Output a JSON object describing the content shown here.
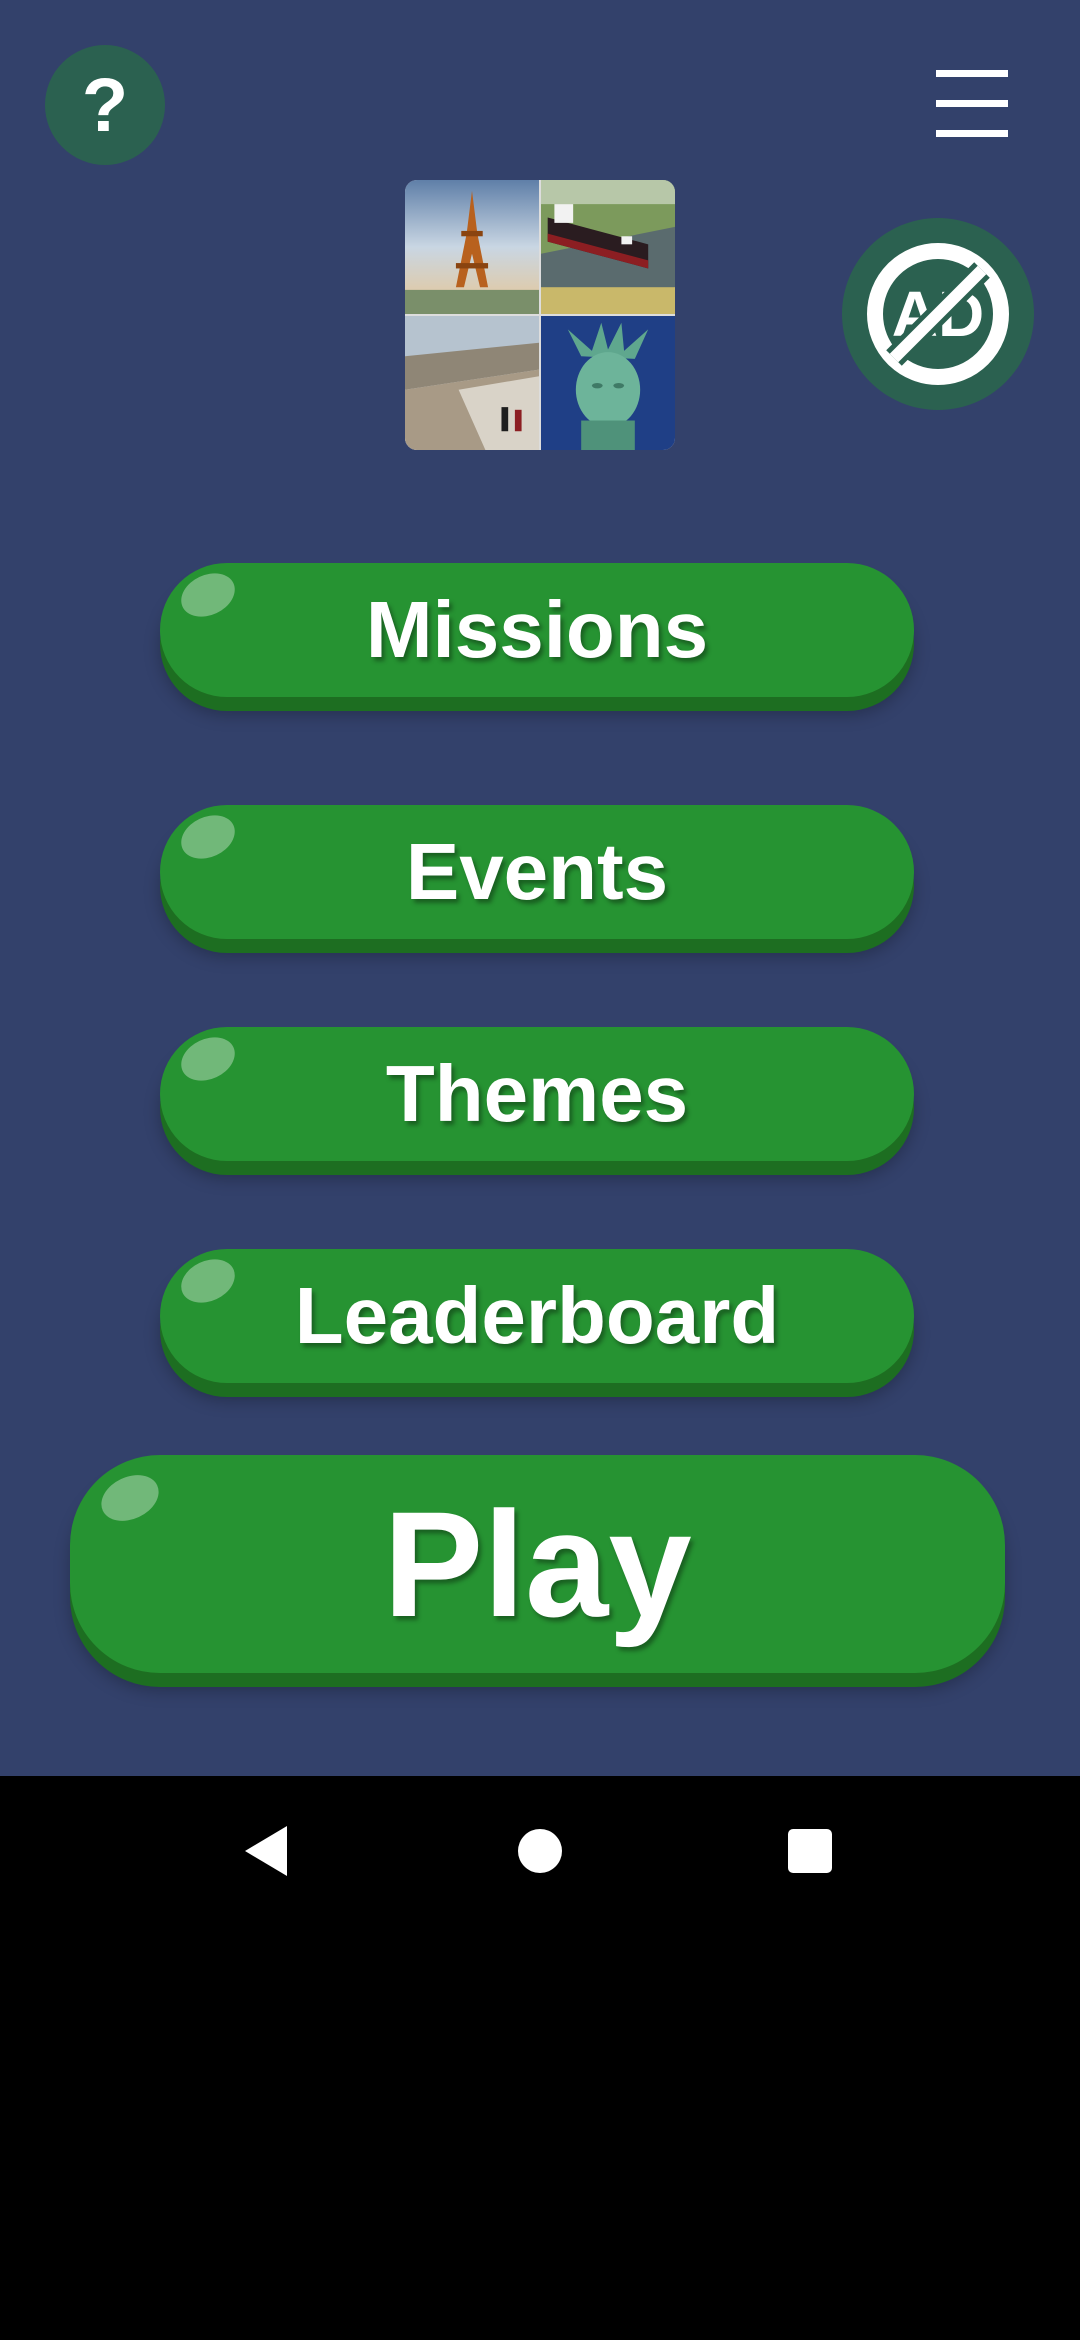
{
  "header": {
    "help_label": "?",
    "help_icon": "question-icon",
    "menu_icon": "hamburger-menu-icon",
    "noads_text": "AD",
    "noads_icon": "no-ads-icon"
  },
  "logo": {
    "tiles": [
      "eiffel-tower",
      "ship-in-canal-lock",
      "great-wall",
      "statue-of-liberty"
    ]
  },
  "menu": {
    "missions": "Missions",
    "events": "Events",
    "themes": "Themes",
    "leaderboard": "Leaderboard",
    "play": "Play"
  },
  "system_nav": {
    "back_icon": "back-triangle-icon",
    "home_icon": "home-circle-icon",
    "recents_icon": "recents-square-icon"
  },
  "colors": {
    "background": "#33416b",
    "button_green": "#269332",
    "button_shadow": "#1d6e21",
    "icon_circle": "#2b6150"
  }
}
